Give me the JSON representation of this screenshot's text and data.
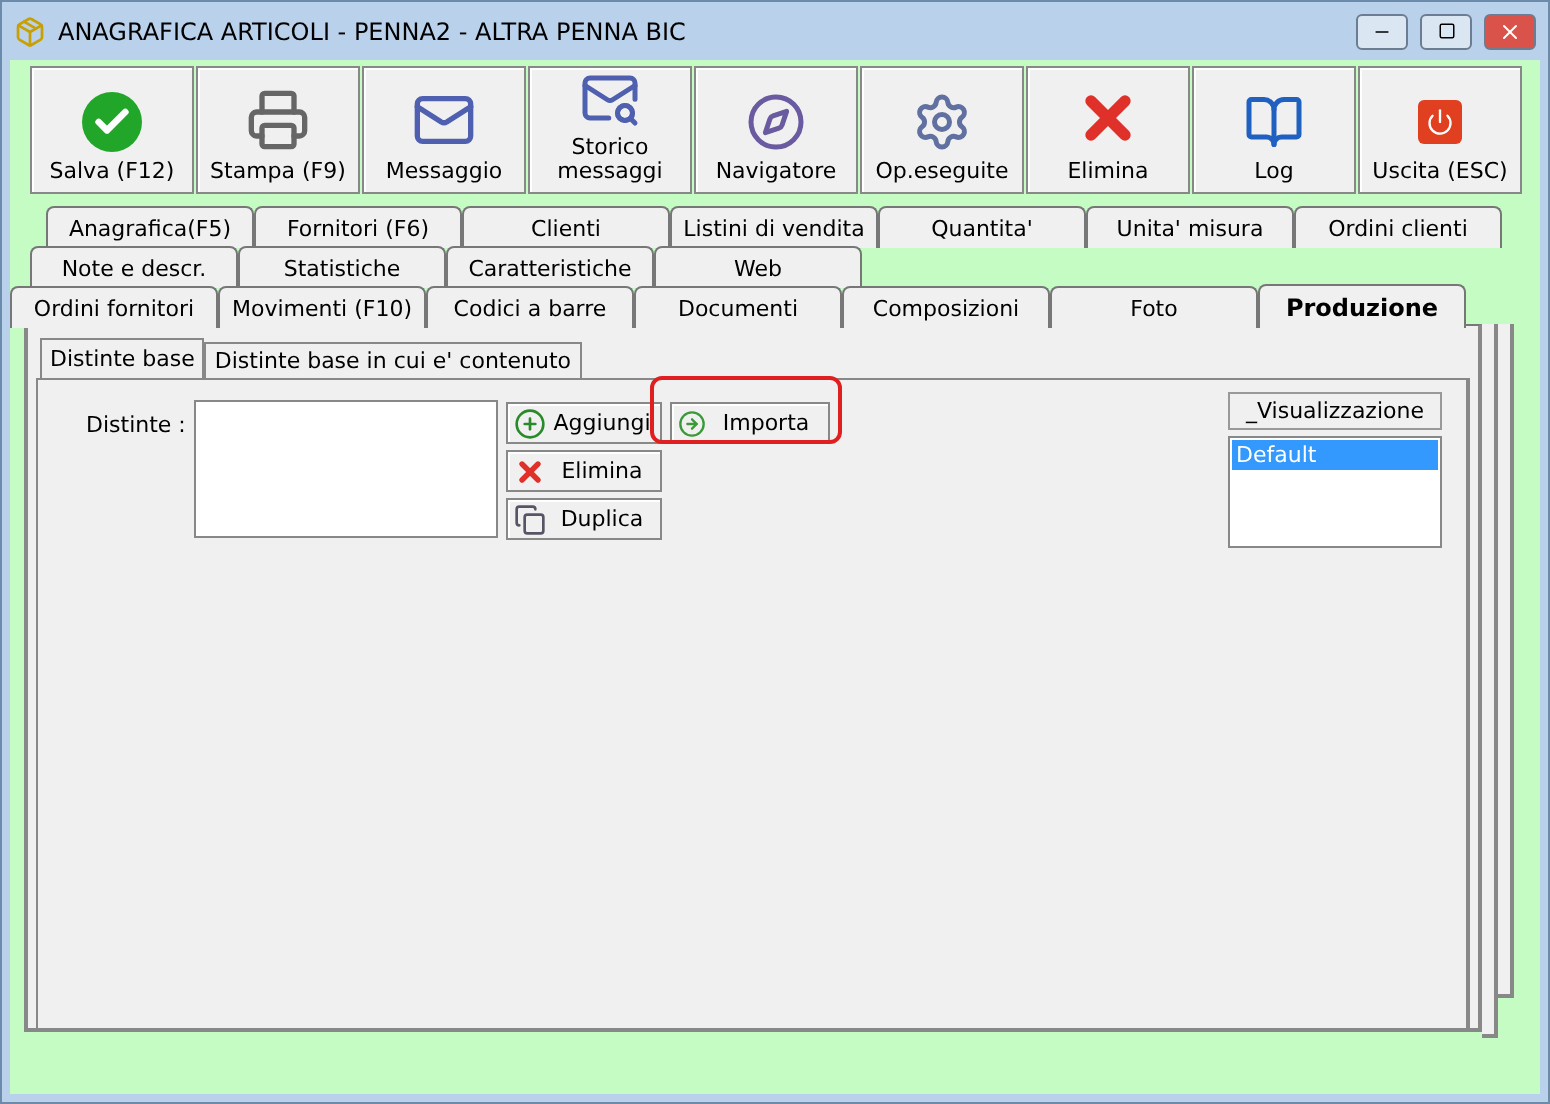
{
  "window": {
    "title": "ANAGRAFICA ARTICOLI - PENNA2 - ALTRA PENNA BIC"
  },
  "toolbar": [
    "Salva (F12)",
    "Stampa (F9)",
    "Messaggio",
    "Storico messaggi",
    "Navigatore",
    "Op.eseguite",
    "Elimina",
    "Log",
    "Uscita (ESC)"
  ],
  "tab_rows": [
    [
      {
        "label": "Anagrafica(F5)",
        "selected": false
      },
      {
        "label": "Fornitori (F6)",
        "selected": false
      },
      {
        "label": "Clienti",
        "selected": false
      },
      {
        "label": "Listini di vendita",
        "selected": false
      },
      {
        "label": "Quantita'",
        "selected": false
      },
      {
        "label": "Unita' misura",
        "selected": false
      },
      {
        "label": "Ordini clienti",
        "selected": false
      }
    ],
    [
      {
        "label": "Note e descr.",
        "selected": false
      },
      {
        "label": "Statistiche",
        "selected": false
      },
      {
        "label": "Caratteristiche",
        "selected": false
      },
      {
        "label": "Web",
        "selected": false
      }
    ],
    [
      {
        "label": "Ordini fornitori",
        "selected": false
      },
      {
        "label": "Movimenti (F10)",
        "selected": false
      },
      {
        "label": "Codici a barre",
        "selected": false
      },
      {
        "label": "Documenti",
        "selected": false
      },
      {
        "label": "Composizioni",
        "selected": false
      },
      {
        "label": "Foto",
        "selected": false
      },
      {
        "label": "Produzione",
        "selected": true
      }
    ]
  ],
  "subtabs": [
    {
      "label": "Distinte base",
      "selected": true
    },
    {
      "label": "Distinte base in cui e' contenuto",
      "selected": false
    }
  ],
  "distinte": {
    "label": "Distinte :",
    "buttons": [
      "Aggiungi",
      "Elimina",
      "Duplica"
    ],
    "import_button": "Importa",
    "highlighted": true
  },
  "visualizzazione": {
    "header": "_Visualizzazione",
    "items": [
      {
        "label": "Default",
        "selected": true
      }
    ]
  }
}
